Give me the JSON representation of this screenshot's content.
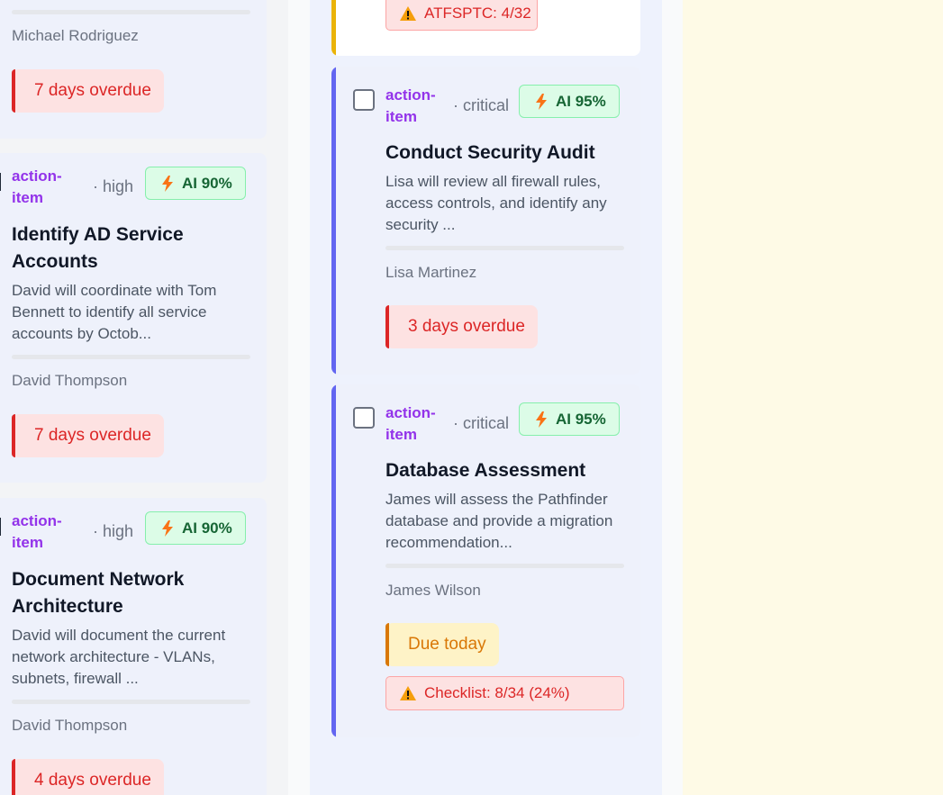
{
  "colors": {
    "overdue": "#dc2626",
    "due_today": "#d97706",
    "type_purple": "#9333ea",
    "ai_green": "#166534",
    "accent_blue": "#6366f1",
    "accent_yellow": "#eab308",
    "app_bg": "#fefae6"
  },
  "left_column": {
    "card_top": {
      "assignee": "Michael Rodriguez",
      "due_label": "7 days overdue"
    },
    "card_2": {
      "type": "action-item",
      "priority": "· high",
      "ai": "AI 90%",
      "title": "Identify AD Service Accounts",
      "description": "David will coordinate with Tom Bennett to identify all service accounts by Octob...",
      "assignee": "David Thompson",
      "due_label": "7 days overdue"
    },
    "card_3": {
      "type": "action-item",
      "priority": "· high",
      "ai": "AI 90%",
      "title": "Document Network Architecture",
      "description": "David will document the current network architecture - VLANs, subnets, firewall ...",
      "assignee": "David Thompson",
      "due_label": "4 days overdue"
    }
  },
  "middle_column": {
    "card_top": {
      "warning": "ATFSPTC: 4/32"
    },
    "card_2": {
      "type": "action-item",
      "priority": "· critical",
      "ai": "AI 95%",
      "title": "Conduct Security Audit",
      "description": "Lisa will review all firewall rules, access controls, and identify any security ...",
      "assignee": "Lisa Martinez",
      "due_label": "3 days overdue"
    },
    "card_3": {
      "type": "action-item",
      "priority": "· critical",
      "ai": "AI 95%",
      "title": "Database Assessment",
      "description": "James will assess the Pathfinder database and provide a migration recommendation...",
      "assignee": "James Wilson",
      "due_label": "Due today",
      "warning": "Checklist: 8/34 (24%)"
    }
  }
}
